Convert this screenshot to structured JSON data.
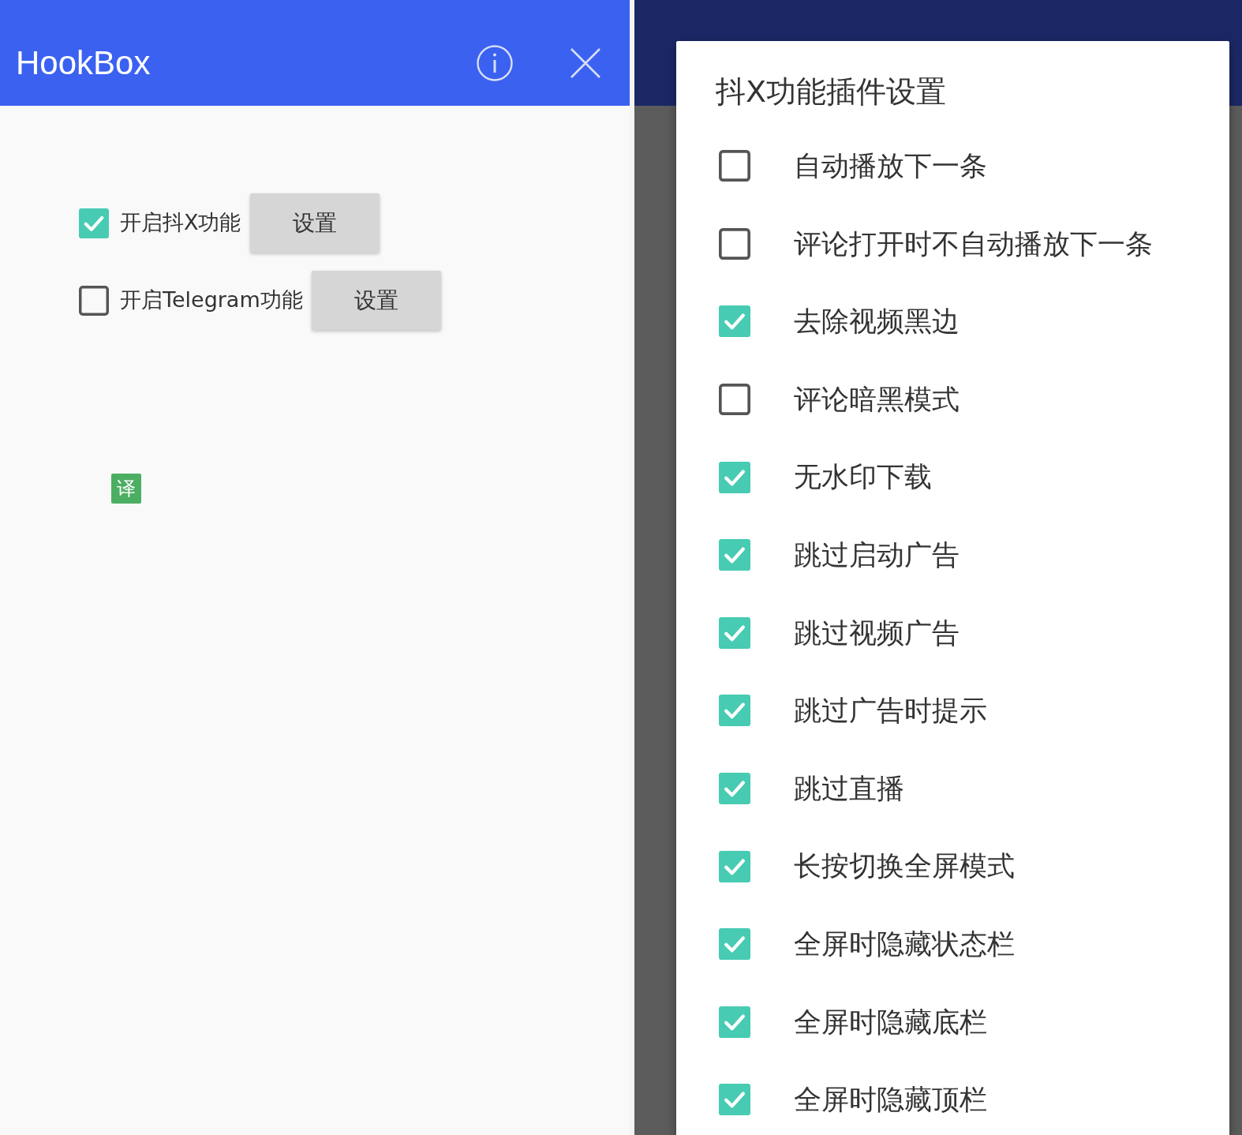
{
  "left_screen": {
    "app_bar": {
      "title": "HookBox"
    },
    "features": [
      {
        "label": "开启抖X功能",
        "checked": true,
        "button": "设置"
      },
      {
        "label": "开启Telegram功能",
        "checked": false,
        "button": "设置"
      }
    ],
    "floating_button": {
      "label": "译"
    }
  },
  "right_screen": {
    "dialog": {
      "title": "抖X功能插件设置",
      "options": [
        {
          "label": "自动播放下一条",
          "checked": false
        },
        {
          "label": "评论打开时不自动播放下一条",
          "checked": false
        },
        {
          "label": "去除视频黑边",
          "checked": true
        },
        {
          "label": "评论暗黑模式",
          "checked": false
        },
        {
          "label": "无水印下载",
          "checked": true
        },
        {
          "label": "跳过启动广告",
          "checked": true
        },
        {
          "label": "跳过视频广告",
          "checked": true
        },
        {
          "label": "跳过广告时提示",
          "checked": true
        },
        {
          "label": "跳过直播",
          "checked": true
        },
        {
          "label": "长按切换全屏模式",
          "checked": true
        },
        {
          "label": "全屏时隐藏状态栏",
          "checked": true
        },
        {
          "label": "全屏时隐藏底栏",
          "checked": true
        },
        {
          "label": "全屏时隐藏顶栏",
          "checked": true
        }
      ]
    }
  }
}
